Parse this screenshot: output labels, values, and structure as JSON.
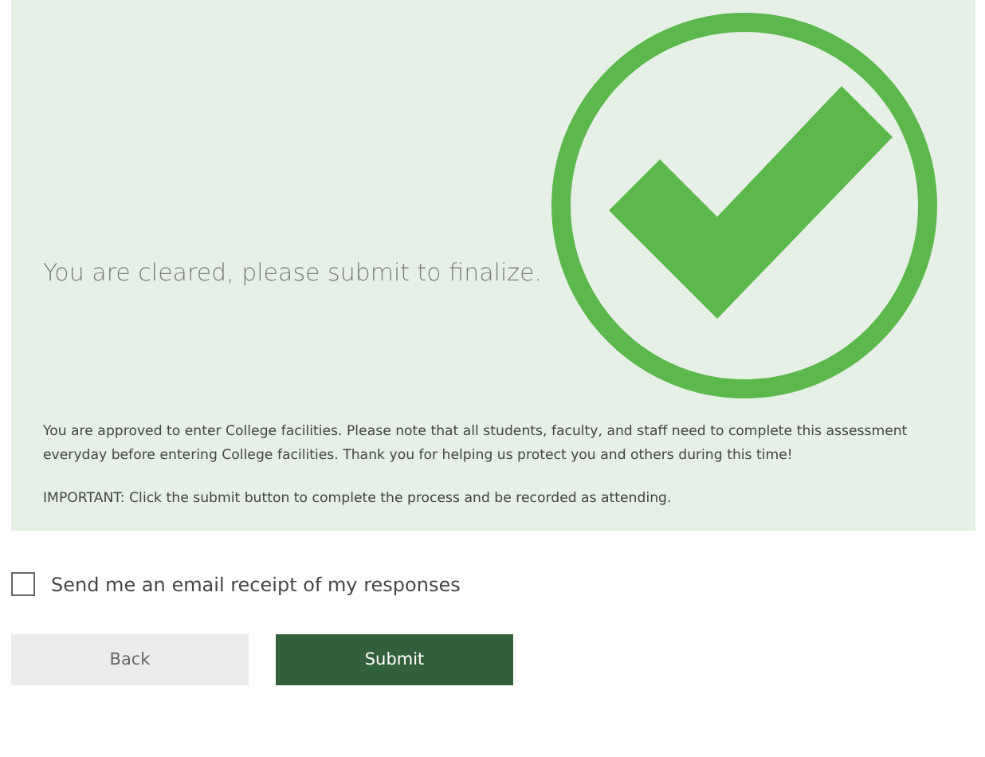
{
  "status_panel": {
    "heading": "You are cleared, please submit to finalize.",
    "message": "You are approved to enter College facilities. Please note that all students, faculty, and staff need to complete this assessment everyday before entering College facilities. Thank you for helping us protect you and others during this time!",
    "notice": "IMPORTANT: Click the submit button to complete the process and be recorded as attending."
  },
  "email_receipt": {
    "label": "Send me an email receipt of my responses",
    "checked": false
  },
  "buttons": [
    {
      "kind": "secondary",
      "label": "Back"
    },
    {
      "kind": "primary",
      "label": "Submit"
    }
  ]
}
